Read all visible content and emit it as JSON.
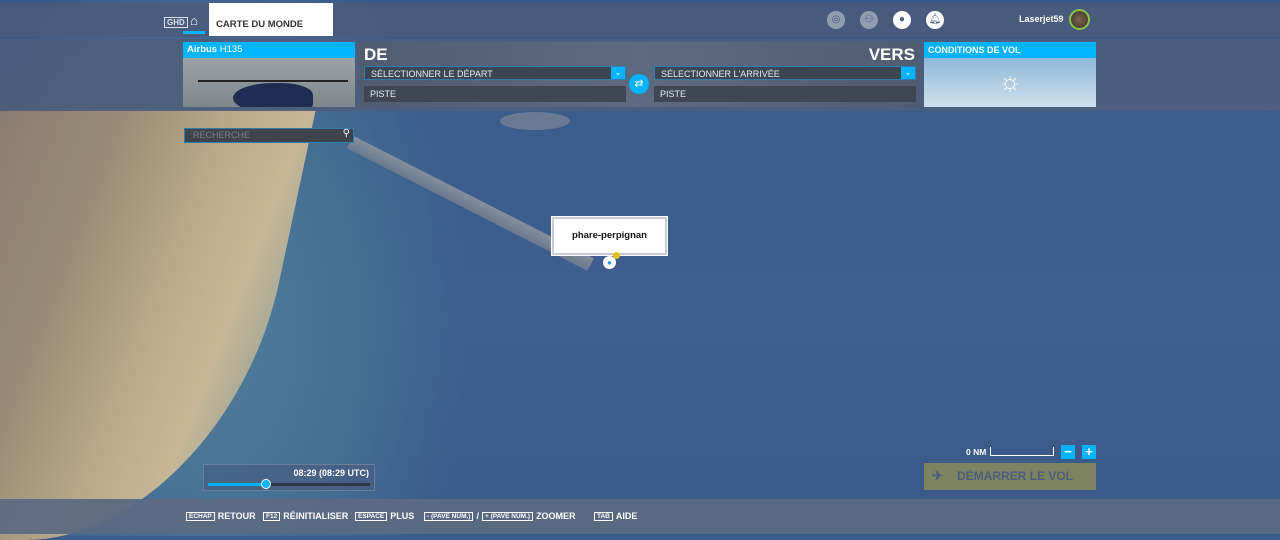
{
  "topbar": {
    "ghd_badge": "GHD",
    "tab_label": "CARTE DU MONDE",
    "username": "Laserjet59",
    "icons": [
      "activity-icon",
      "friends-icon",
      "profile-icon",
      "notifications-icon"
    ]
  },
  "aircraft": {
    "brand": "Airbus",
    "model": "H135"
  },
  "route": {
    "from_label": "DE",
    "to_label": "VERS",
    "departure_select": "SÉLECTIONNER LE DÉPART",
    "arrival_select": "SÉLECTIONNER L'ARRIVÉE",
    "departure_runway": "PISTE",
    "arrival_runway": "PISTE"
  },
  "weather": {
    "title": "CONDITIONS DE VOL",
    "icon": "partly-cloudy-icon"
  },
  "search": {
    "placeholder": "RECHERCHE"
  },
  "map": {
    "marker_label": "phare-perpignan",
    "scale_label": "0 NM"
  },
  "time": {
    "label": "08:29 (08:29 UTC)",
    "slider_fraction": 0.36
  },
  "start_button": "DÉMARRER LE VOL",
  "hints": [
    {
      "key": "ECHAP",
      "label": "RETOUR"
    },
    {
      "key": "F12",
      "label": "RÉINITIALISER"
    },
    {
      "key": "ESPACE",
      "label": "PLUS"
    },
    {
      "key": "- (PAVE NUM.)",
      "sep": "/",
      "key2": "+ (PAVE NUM.)",
      "label": "ZOOMER"
    },
    {
      "key": "TAB",
      "label": "AIDE"
    }
  ],
  "colors": {
    "accent": "#00b4ff",
    "start_button": "#7e8361"
  }
}
